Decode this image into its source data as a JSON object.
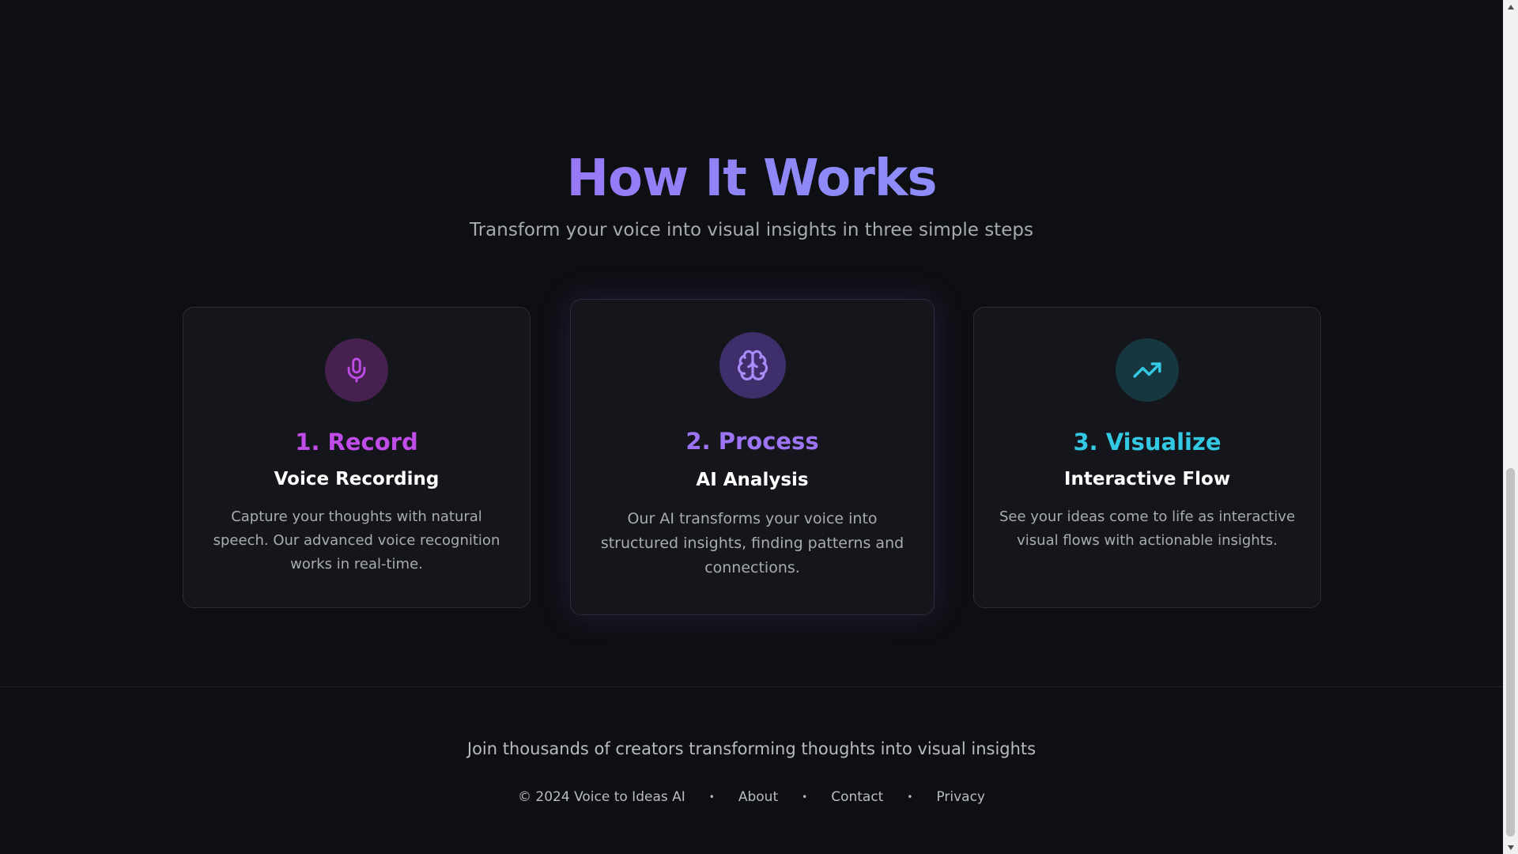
{
  "how_it_works": {
    "title": "How It Works",
    "subtitle": "Transform your voice into visual insights in three simple steps"
  },
  "steps": [
    {
      "icon": "microphone-icon",
      "title": "1. Record",
      "subtitle": "Voice Recording",
      "description": "Capture your thoughts with natural speech. Our advanced voice recognition works in real-time.",
      "accent": "#c04ce9"
    },
    {
      "icon": "brain-icon",
      "title": "2. Process",
      "subtitle": "AI Analysis",
      "description": "Our AI transforms your voice into structured insights, finding patterns and connections.",
      "accent": "#9d74f4"
    },
    {
      "icon": "trending-up-icon",
      "title": "3. Visualize",
      "subtitle": "Interactive Flow",
      "description": "See your ideas come to life as interactive visual flows with actionable insights.",
      "accent": "#33c8e4"
    }
  ],
  "footer": {
    "tagline": "Join thousands of creators transforming thoughts into visual insights",
    "copyright": "© 2024 Voice to Ideas AI",
    "separator": "•",
    "links": [
      "About",
      "Contact",
      "Privacy"
    ]
  },
  "theme": {
    "background": "#0e0f13",
    "card_background": "#15161b",
    "title_gradient": [
      "#b14ef0",
      "#8aa3fb"
    ]
  }
}
